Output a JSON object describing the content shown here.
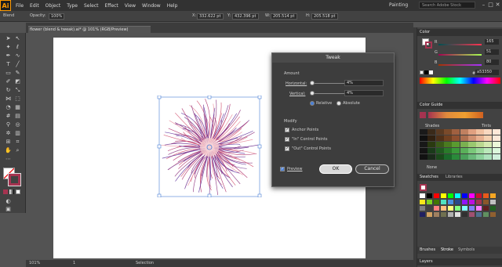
{
  "menubar": {
    "logo": "Ai",
    "items": [
      "File",
      "Edit",
      "Object",
      "Type",
      "Select",
      "Effect",
      "View",
      "Window",
      "Help"
    ],
    "workspace": "Painting",
    "search_placeholder": "Search Adobe Stock"
  },
  "controlbar": {
    "selection_label": "Blend",
    "opacity_label": "Opacity:",
    "opacity_value": "100%",
    "x_label": "X:",
    "x_value": "332.622 pt",
    "y_label": "Y:",
    "y_value": "432.396 pt",
    "w_label": "W:",
    "w_value": "205.514 pt",
    "h_label": "H:",
    "h_value": "205.518 pt"
  },
  "document": {
    "tab_title": "flower (blend & tweak).ai* @ 101% (RGB/Preview)"
  },
  "statusbar": {
    "zoom": "101%",
    "page": "1",
    "tool": "Selection"
  },
  "tweak_dialog": {
    "title": "Tweak",
    "amount_label": "Amount",
    "horizontal_label": "Horizontal:",
    "horizontal_value": "4%",
    "vertical_label": "Vertical:",
    "vertical_value": "4%",
    "relative_label": "Relative",
    "absolute_label": "Absolute",
    "modify_label": "Modify",
    "anchor_label": "Anchor Points",
    "in_label": "\"In\" Control Points",
    "out_label": "\"Out\" Control Points",
    "preview_label": "Preview",
    "ok_label": "OK",
    "cancel_label": "Cancel"
  },
  "panels": {
    "color_tab": "Color",
    "r_label": "R",
    "r_value": "165",
    "g_label": "G",
    "g_value": "51",
    "b_label": "B",
    "b_value": "80",
    "hex_value": "a53350",
    "color_guide_tab": "Color Guide",
    "shades_label": "Shades",
    "tints_label": "Tints",
    "none_label": "None",
    "swatches_tab": "Swatches",
    "libraries_tab": "Libraries",
    "brushes_tab": "Brushes",
    "stroke_tab": "Stroke",
    "symbols_tab": "Symbols",
    "layers_tab": "Layers"
  },
  "colors": {
    "accent": "#a53350",
    "highlight": "#ff9a00",
    "selection_blue": "#4a7fd6"
  }
}
